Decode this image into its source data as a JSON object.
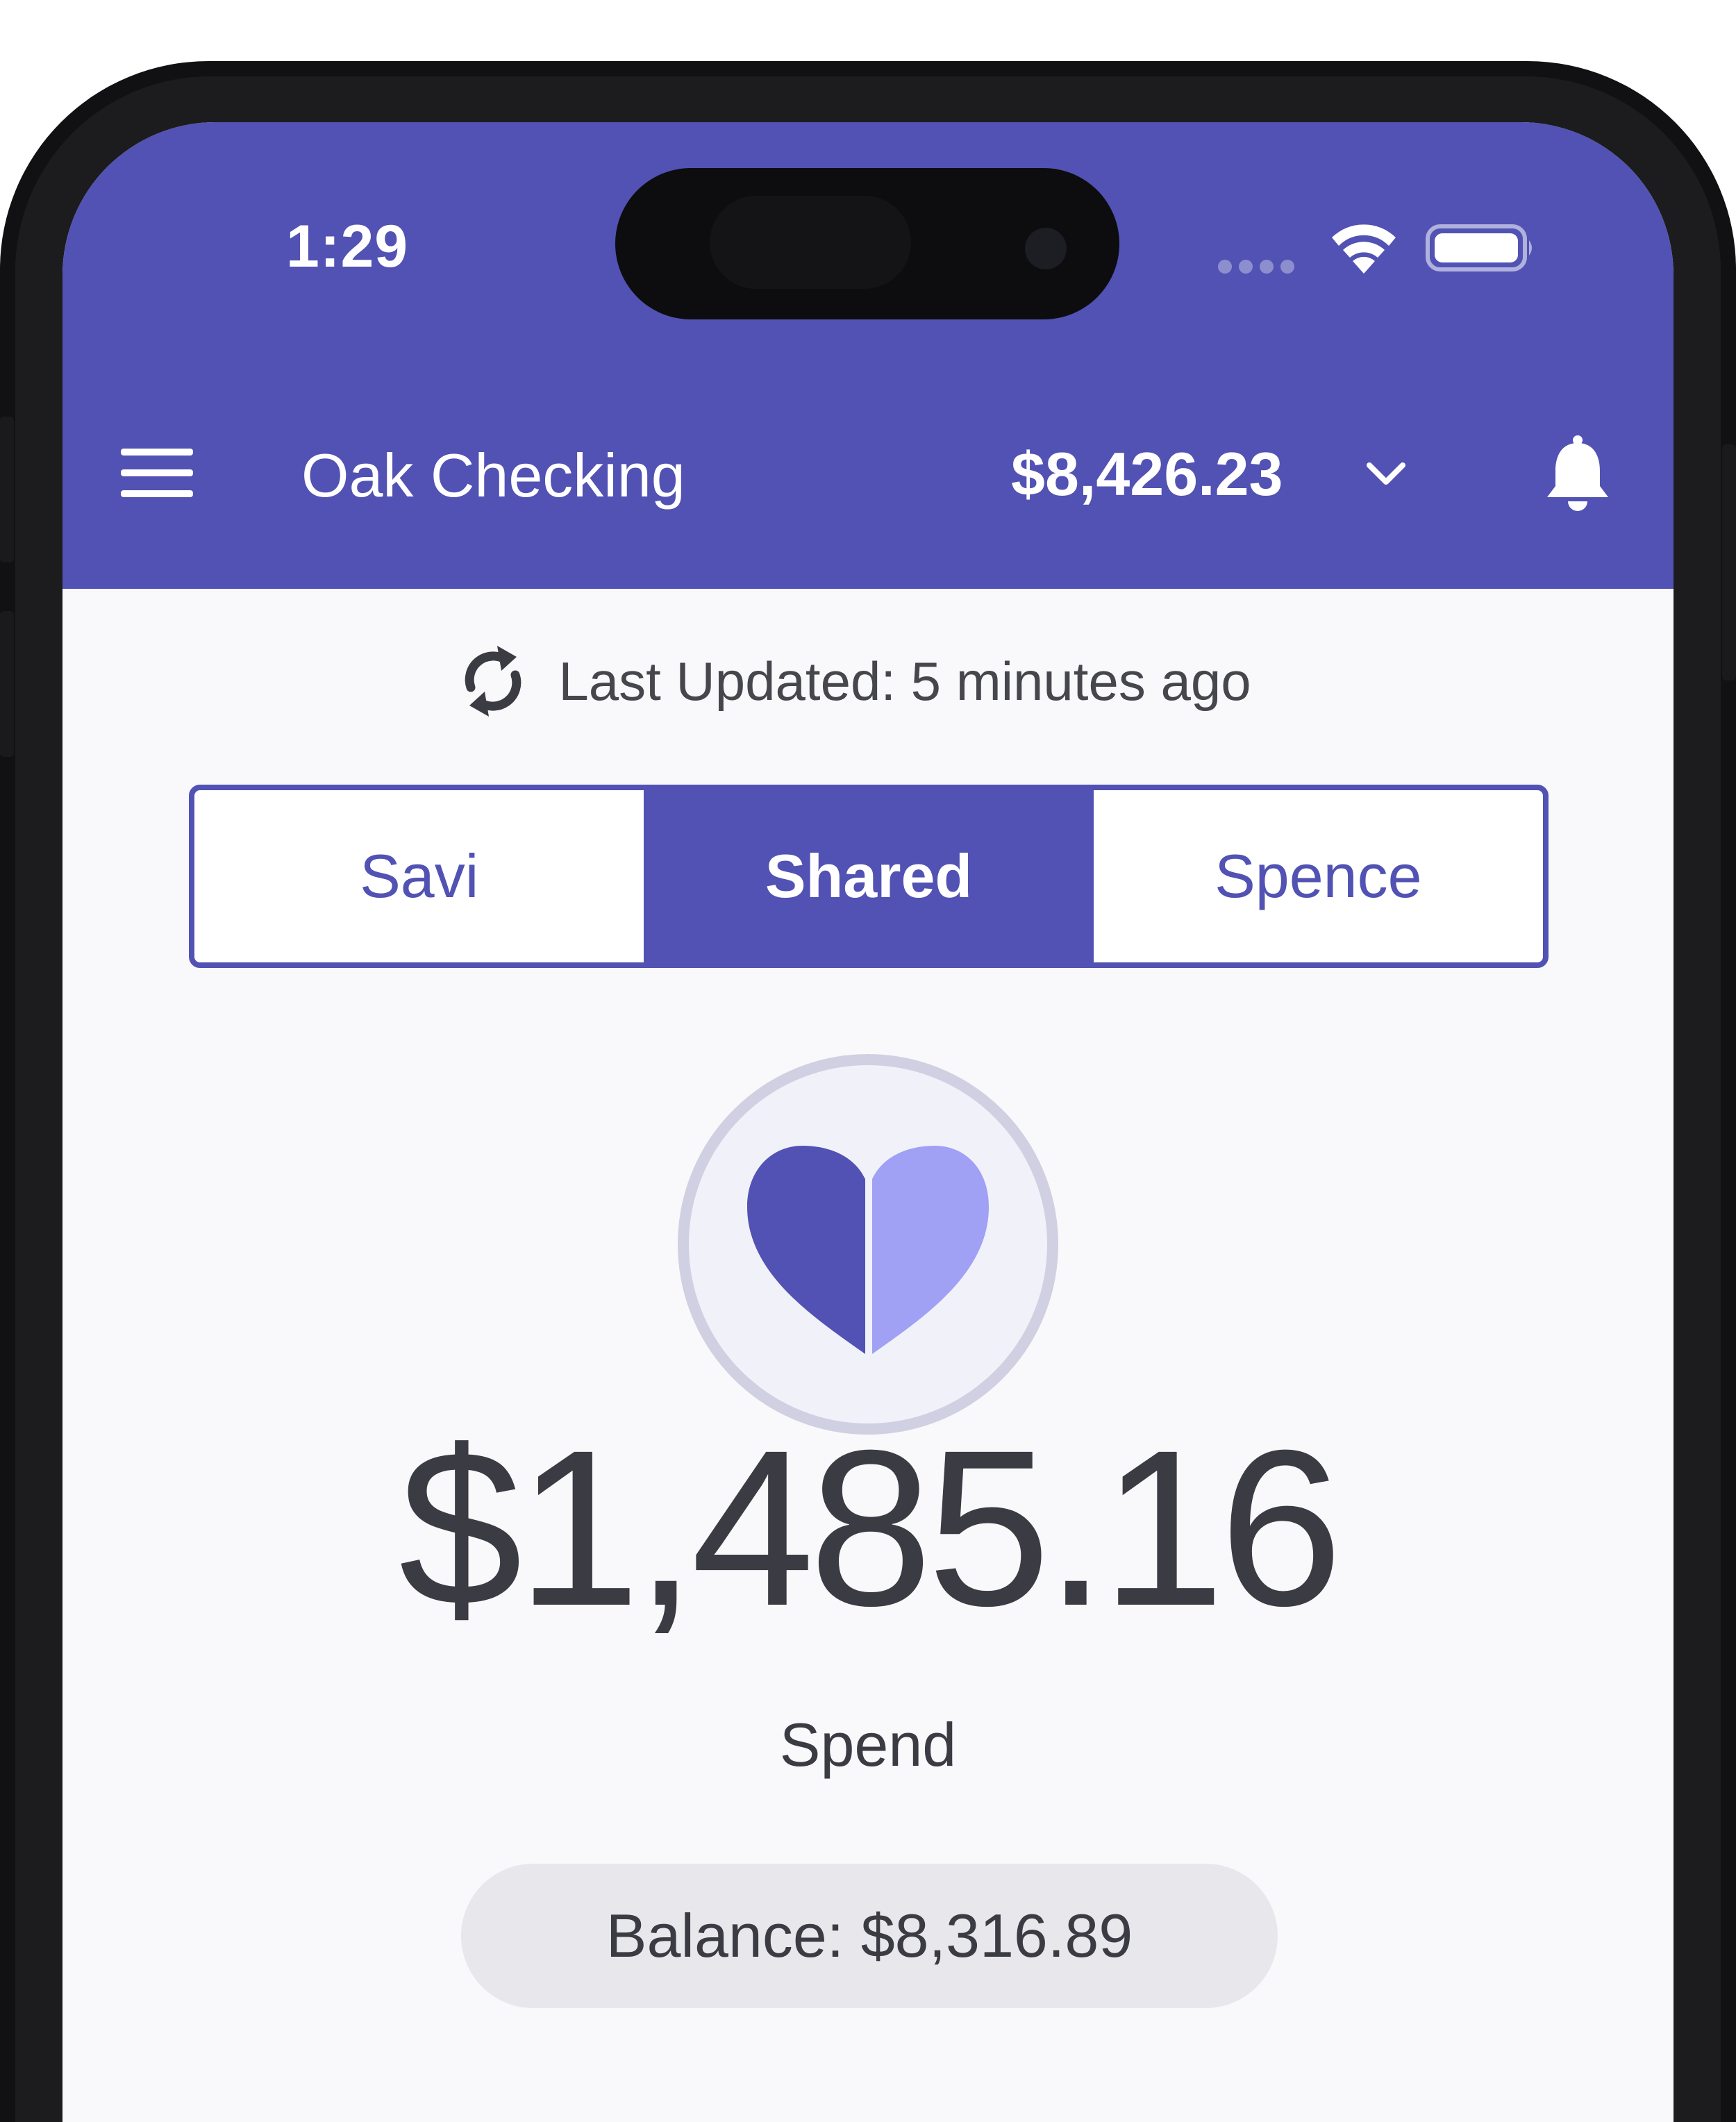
{
  "status_bar": {
    "time": "1:29",
    "wifi_icon": "wifi-icon",
    "battery_icon": "battery-icon"
  },
  "header": {
    "menu_icon": "hamburger-menu-icon",
    "account_name": "Oak Checking",
    "account_total": "$8,426.23",
    "dropdown_icon": "chevron-down-icon",
    "notification_icon": "bell-icon"
  },
  "sync": {
    "icon": "refresh-icon",
    "text": "Last Updated: 5 minutes ago"
  },
  "tabs": [
    {
      "label": "Savi",
      "active": false
    },
    {
      "label": "Shared",
      "active": true
    },
    {
      "label": "Spence",
      "active": false
    }
  ],
  "summary": {
    "avatar_icon": "heart-icon",
    "amount": "$1,485.16",
    "amount_label": "Spend",
    "balance": "Balance: $8,316.89"
  },
  "colors": {
    "brand": "#5152b3",
    "brand_light": "#a0a0f5",
    "background": "#f9f9fb",
    "text": "#3b3b43"
  }
}
